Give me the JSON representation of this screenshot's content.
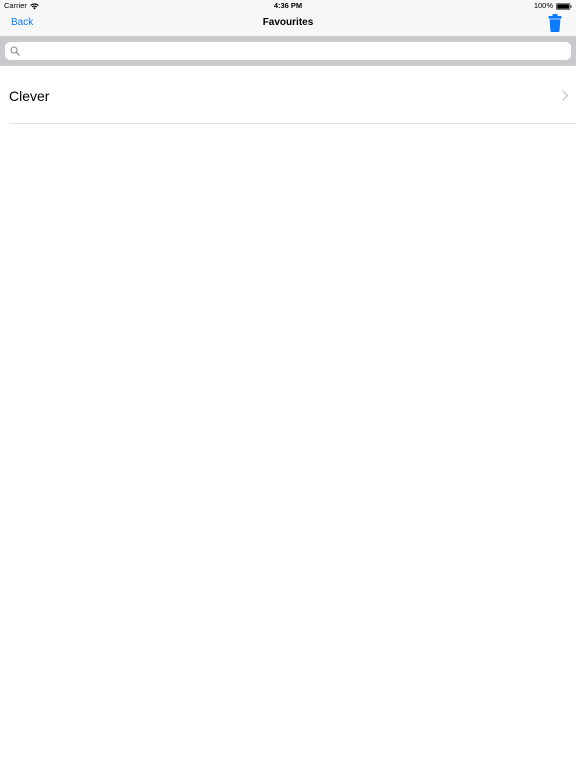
{
  "status_bar": {
    "carrier": "Carrier",
    "time": "4:36 PM",
    "battery": "100%"
  },
  "nav": {
    "back_label": "Back",
    "title": "Favourites",
    "trash_icon": "trash-icon"
  },
  "search": {
    "placeholder": "",
    "value": ""
  },
  "list": {
    "items": [
      {
        "label": "Clever"
      }
    ]
  },
  "colors": {
    "accent": "#0a7aff",
    "search_bar_bg": "#c9c9ce",
    "nav_bg": "#f7f7f7"
  }
}
